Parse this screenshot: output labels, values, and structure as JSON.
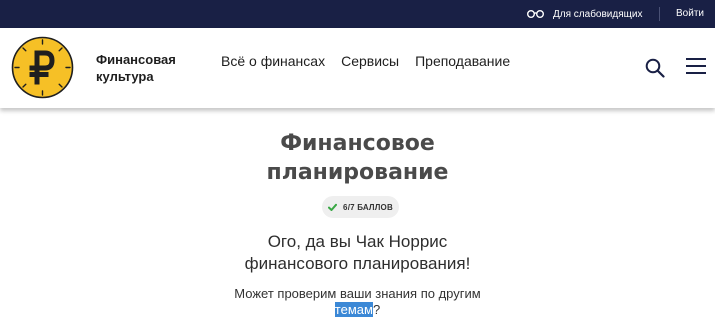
{
  "topbar": {
    "accessibility_label": "Для слабовидящих",
    "login_label": "Войти",
    "background": "#192045"
  },
  "header": {
    "logo_icon": "ruble-icon",
    "brand_line1": "Финансовая",
    "brand_line2": "культура",
    "nav": [
      {
        "label": "Всё о финансах"
      },
      {
        "label": "Сервисы"
      },
      {
        "label": "Преподавание"
      }
    ]
  },
  "main": {
    "title_line1": "Финансовое",
    "title_line2": "планирование",
    "score_label": "6/7 баллов",
    "message_line1": "Ого, да вы Чак Норрис",
    "message_line2": "финансового планирования!",
    "suggest_line1": "Может проверим ваши знания по другим",
    "suggest_link": "темам",
    "suggest_tail": "?"
  },
  "colors": {
    "accent_yellow": "#f6c026",
    "check_green": "#39a845",
    "selection": "#3b88d6"
  }
}
